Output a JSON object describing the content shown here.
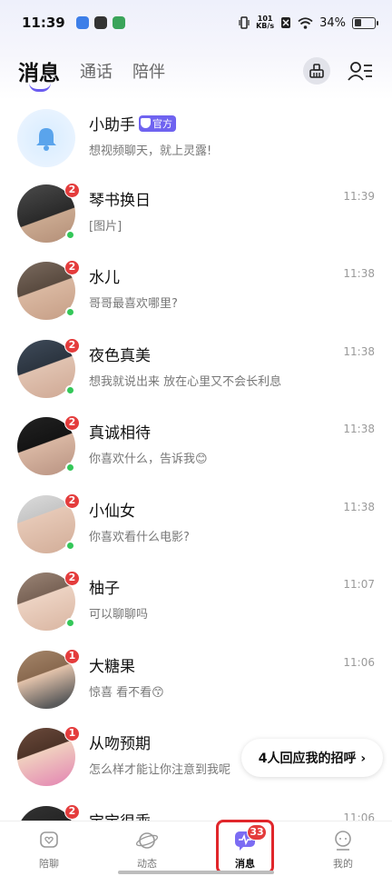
{
  "status_bar": {
    "time": "11:39",
    "net_speed_top": "101",
    "net_speed_bottom": "KB/s",
    "battery": "34%"
  },
  "header": {
    "tabs": [
      {
        "label": "消息",
        "active": true
      },
      {
        "label": "通话",
        "active": false
      },
      {
        "label": "陪伴",
        "active": false
      }
    ],
    "icons": [
      "cleaner-icon",
      "contacts-icon"
    ]
  },
  "conversations": [
    {
      "name": "小助手",
      "official_tag": "官方",
      "preview": "想视频聊天，就上灵露!",
      "time": "",
      "badge": "",
      "online": false
    },
    {
      "name": "琴书换日",
      "preview": "[图片]",
      "time": "11:39",
      "badge": "2",
      "online": true
    },
    {
      "name": "水儿",
      "preview": "哥哥最喜欢哪里?",
      "time": "11:38",
      "badge": "2",
      "online": true
    },
    {
      "name": "夜色真美",
      "preview": "想我就说出来 放在心里又不会长利息",
      "time": "11:38",
      "badge": "2",
      "online": true
    },
    {
      "name": "真诚相待",
      "preview": "你喜欢什么，告诉我😊",
      "time": "11:38",
      "badge": "2",
      "online": true
    },
    {
      "name": "小仙女",
      "preview": "你喜欢看什么电影?",
      "time": "11:38",
      "badge": "2",
      "online": true
    },
    {
      "name": "柚子",
      "preview": "可以聊聊吗",
      "time": "11:07",
      "badge": "2",
      "online": true
    },
    {
      "name": "大糖果",
      "preview": "惊喜  看不看😙",
      "time": "11:06",
      "badge": "1",
      "online": false
    },
    {
      "name": "从吻预期",
      "preview": "怎么样才能让你注意到我呢",
      "time": "",
      "badge": "1",
      "online": false
    },
    {
      "name": "宝宝很乖",
      "preview": "",
      "time": "11:06",
      "badge": "2",
      "online": false
    }
  ],
  "reply_pill": {
    "label": "4人回应我的招呼 ›"
  },
  "bottom_nav": {
    "items": [
      {
        "label": "陪聊",
        "active": false
      },
      {
        "label": "动态",
        "active": false
      },
      {
        "label": "消息",
        "active": true,
        "badge": "33"
      },
      {
        "label": "我的",
        "active": false
      }
    ]
  },
  "colors": {
    "accent": "#6b5cf0",
    "badge_red": "#e43c3c",
    "online_green": "#34c759",
    "highlight_red": "#e0262b"
  }
}
